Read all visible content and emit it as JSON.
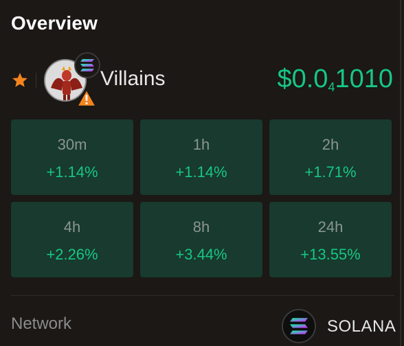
{
  "header": {
    "title": "Overview"
  },
  "token": {
    "name": "Villains",
    "price_prefix": "$0.0",
    "price_subscript": "4",
    "price_suffix": "1010"
  },
  "timeframes": [
    {
      "label": "30m",
      "change": "+1.14%"
    },
    {
      "label": "1h",
      "change": "+1.14%"
    },
    {
      "label": "2h",
      "change": "+1.71%"
    },
    {
      "label": "4h",
      "change": "+2.26%"
    },
    {
      "label": "8h",
      "change": "+3.44%"
    },
    {
      "label": "24h",
      "change": "+13.55%"
    }
  ],
  "network": {
    "label": "Network",
    "name": "SOLANA"
  },
  "icons": {
    "star": "star-icon",
    "chain": "solana-icon",
    "warning": "warning-icon"
  },
  "colors": {
    "accent": "#16c784",
    "star": "#f5841f",
    "warning": "#f5841f",
    "cell_bg": "#183a2f",
    "background": "#1b1816"
  }
}
